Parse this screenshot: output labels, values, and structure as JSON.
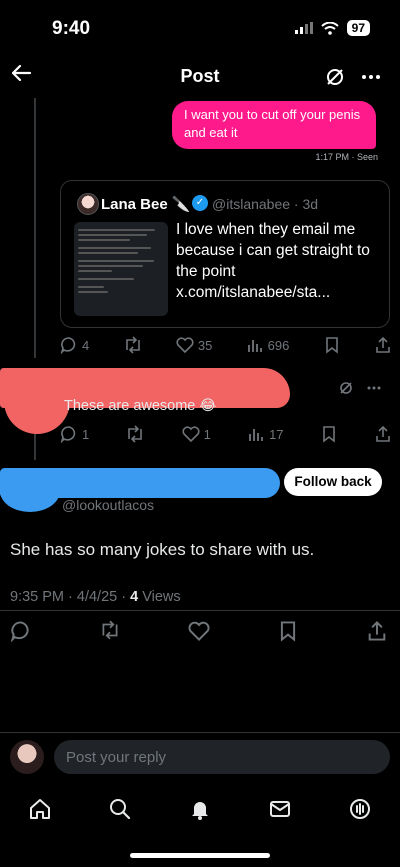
{
  "status_bar": {
    "time": "9:40",
    "battery": "97"
  },
  "nav": {
    "title": "Post"
  },
  "dm": {
    "message": "I want you to cut off your penis and eat it",
    "meta": "1:17 PM · Seen"
  },
  "quote": {
    "name": "Lana Bee 🔪",
    "handle": "@itslanabee · 3d",
    "text": "I love when they email me because i can get straight to the point x.com/itslanabee/sta...",
    "stats": {
      "replies": "4",
      "likes": "35",
      "views": "696"
    }
  },
  "reply_post": {
    "text": "These are awesome 😂",
    "stats": {
      "replies": "1",
      "likes": "1",
      "views": "17"
    }
  },
  "main_post": {
    "handle_peek": "@lookoutlacos",
    "follow_label": "Follow back",
    "text": "She has so many jokes to share with us.",
    "date": "9:35 PM · 4/4/25 · ",
    "views_count": "4",
    "views_label": " Views"
  },
  "composer": {
    "placeholder": "Post your reply"
  },
  "colors": {
    "accent": "#1d9bf0",
    "dm_bubble": "#ff1a8c",
    "redact_red": "#f26464",
    "redact_blue": "#3a9bf0"
  },
  "icons": [
    "back-arrow-icon",
    "grok-icon",
    "more-icon",
    "reply-icon",
    "repost-icon",
    "like-icon",
    "views-icon",
    "bookmark-icon",
    "share-icon",
    "home-icon",
    "search-icon",
    "notifications-icon",
    "messages-icon",
    "spaces-icon"
  ]
}
